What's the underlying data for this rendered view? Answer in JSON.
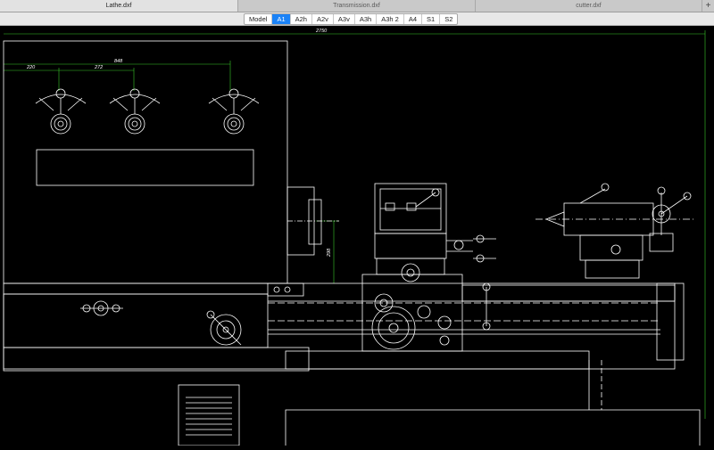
{
  "tabs": [
    {
      "label": "Lathe.dxf",
      "active": true
    },
    {
      "label": "Transmission.dxf",
      "active": false
    },
    {
      "label": "cutter.dxf",
      "active": false
    }
  ],
  "add_tab_label": "+",
  "layouts": [
    "Model",
    "A1",
    "A2h",
    "A2v",
    "A3v",
    "A3h",
    "A3h 2",
    "A4",
    "S1",
    "S2"
  ],
  "selected_layout": "A1",
  "drawing": {
    "dimensions": [
      "2750",
      "848",
      "220",
      "272",
      "298"
    ]
  },
  "colors": {
    "background": "#000000",
    "lines": "#ffffff",
    "dimensions": "#39c92b",
    "accent": "#1a82f7"
  }
}
